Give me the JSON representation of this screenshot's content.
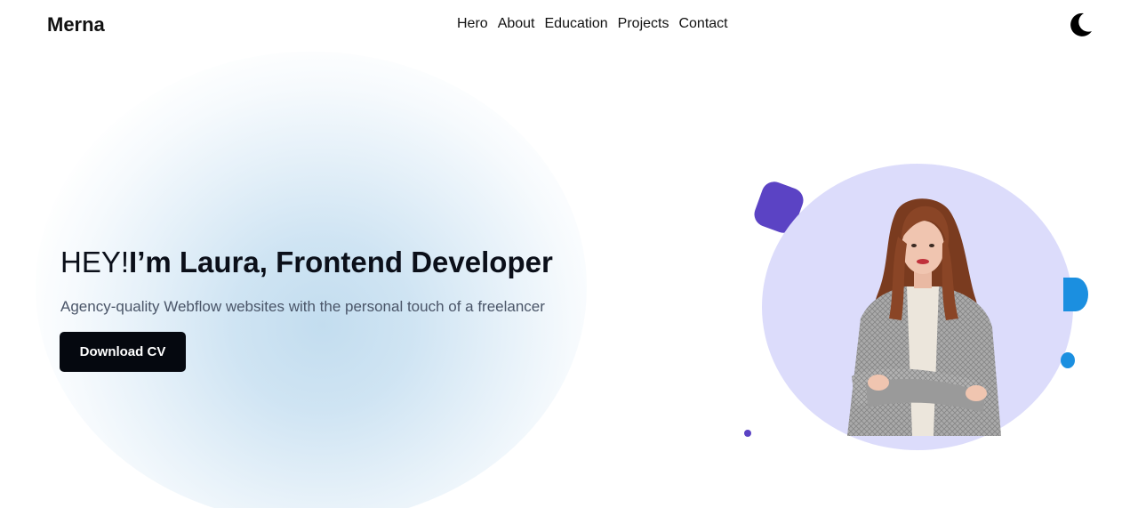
{
  "brand": {
    "logo": "Merna"
  },
  "nav": {
    "items": [
      {
        "label": "Hero"
      },
      {
        "label": "About"
      },
      {
        "label": "Education"
      },
      {
        "label": "Projects"
      },
      {
        "label": "Contact"
      }
    ],
    "theme_icon": "moon-icon"
  },
  "hero": {
    "greeting": "HEY!",
    "headline": "I’m Laura, Frontend Developer",
    "subtitle": "Agency-quality Webflow websites with the personal touch of a freelancer",
    "cta_label": "Download CV"
  },
  "colors": {
    "accent_purple": "#5b43c4",
    "accent_blue": "#1b8fe0",
    "circle_bg": "#dcdcfb",
    "button_bg": "#05080f"
  }
}
